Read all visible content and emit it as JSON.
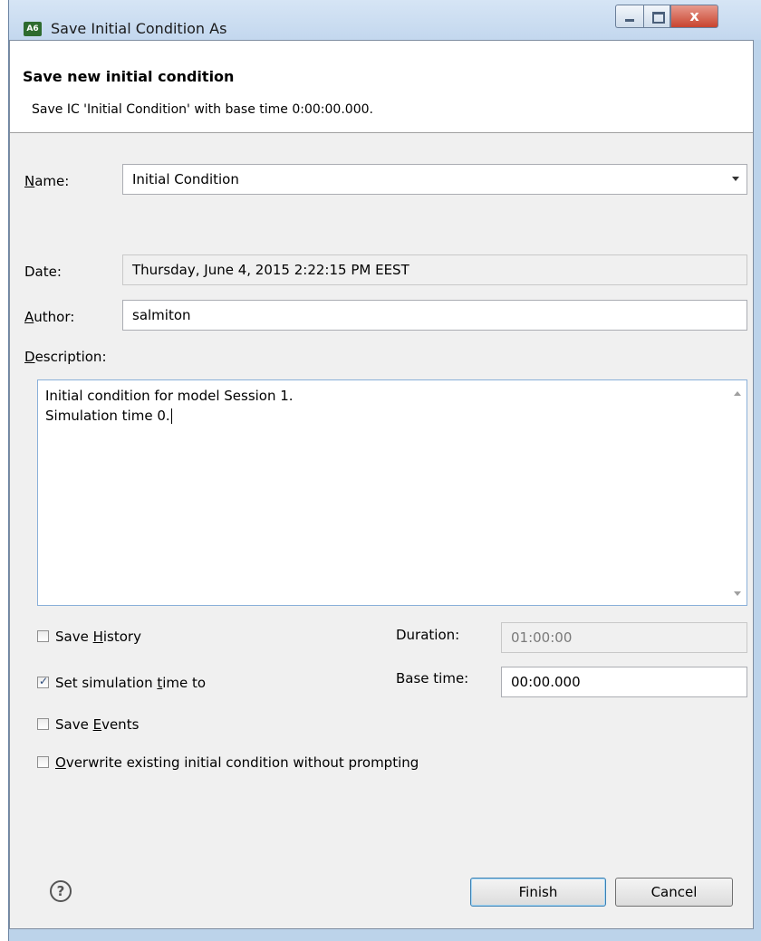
{
  "window": {
    "app_icon_text": "A6",
    "title": "Save Initial Condition As",
    "close_glyph": "x"
  },
  "banner": {
    "title": "Save new initial condition",
    "message": "Save IC 'Initial Condition' with base time 0:00:00.000."
  },
  "form": {
    "name_label_prefix": "N",
    "name_label_rest": "ame:",
    "name_value": "Initial Condition",
    "date_label": "Date:",
    "date_value": "Thursday, June 4, 2015 2:22:15 PM EEST",
    "author_label_prefix": "A",
    "author_label_rest": "uthor:",
    "author_value": "salmiton",
    "description_label_prefix": "D",
    "description_label_rest": "escription:",
    "description_value": "Initial condition for model Session 1.\nSimulation time 0."
  },
  "options": {
    "save_history": {
      "pre": "Save ",
      "mnemonic": "H",
      "post": "istory",
      "checked": false
    },
    "set_sim_time": {
      "pre": "Set simulation ",
      "mnemonic": "t",
      "post": "ime to",
      "checked": true
    },
    "save_events": {
      "pre": "Save ",
      "mnemonic": "E",
      "post": "vents",
      "checked": false
    },
    "overwrite": {
      "pre": "",
      "mnemonic": "O",
      "post": "verwrite existing initial condition without prompting",
      "checked": false
    },
    "duration_label": "Duration:",
    "duration_value": "01:00:00",
    "base_time_label": "Base time:",
    "base_time_value": "00:00.000"
  },
  "footer": {
    "help_glyph": "?",
    "finish_label": "Finish",
    "cancel_label": "Cancel"
  },
  "colors": {
    "accent": "#3c7fb1",
    "window_frame": "#bcd3ea",
    "close_button": "#c9442f"
  },
  "icons": {
    "app": "app-logo-icon",
    "help": "help-icon",
    "combo": "chevron-down-icon"
  }
}
